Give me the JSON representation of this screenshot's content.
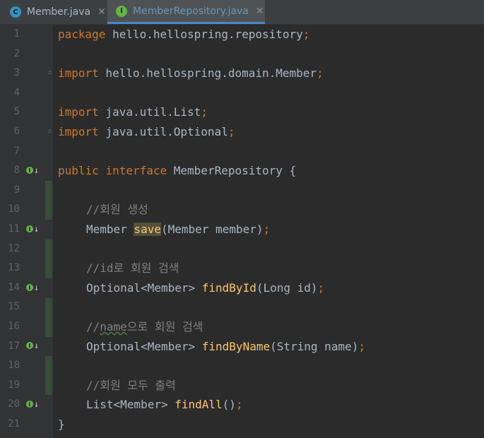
{
  "tabs": [
    {
      "label": "Member.java",
      "icon": "class-icon",
      "icon_color": "#3592c4",
      "icon_letter": "C"
    },
    {
      "label": "MemberRepository.java",
      "icon": "interface-icon",
      "icon_color": "#62b543",
      "icon_letter": "I"
    }
  ],
  "tab_close_glyph": "✕",
  "line_numbers": [
    "1",
    "2",
    "3",
    "4",
    "5",
    "6",
    "7",
    "8",
    "9",
    "10",
    "11",
    "12",
    "13",
    "14",
    "15",
    "16",
    "17",
    "18",
    "19",
    "20",
    "21"
  ],
  "gutter_marker": {
    "letter": "I",
    "arrow": "↓"
  },
  "code": {
    "l1_kw": "package",
    "l1_rest": " hello.hellospring.repository",
    "l1_semi": ";",
    "l3_kw": "import",
    "l3_rest": " hello.hellospring.domain.Member",
    "l3_semi": ";",
    "l5_kw": "import",
    "l5_rest": " java.util.List",
    "l5_semi": ";",
    "l6_kw": "import",
    "l6_rest": " java.util.Optional",
    "l6_semi": ";",
    "l8_kw1": "public",
    "l8_kw2": "interface",
    "l8_rest": " MemberRepository {",
    "l10_comment": "//회원 생성",
    "l11_type": "Member ",
    "l11_method": "save",
    "l11_params": "(Member member)",
    "l11_semi": ";",
    "l13_comment": "//id로 회원 검색",
    "l14_type": "Optional<Member> ",
    "l14_method": "findById",
    "l14_params": "(Long id)",
    "l14_semi": ";",
    "l16_comment_a": "//",
    "l16_comment_b": "name",
    "l16_comment_c": "으로 회원 검색",
    "l17_type": "Optional<Member> ",
    "l17_method": "findByName",
    "l17_params": "(String name)",
    "l17_semi": ";",
    "l19_comment": "//회원 모두 출력",
    "l20_type": "List<Member> ",
    "l20_method": "findAll",
    "l20_params": "()",
    "l20_semi": ";",
    "l21_close": "}"
  },
  "colors": {
    "keyword": "#cc7832",
    "comment": "#808080",
    "method": "#ffc66d",
    "text": "#a9b7c6",
    "background": "#2b2b2b"
  }
}
